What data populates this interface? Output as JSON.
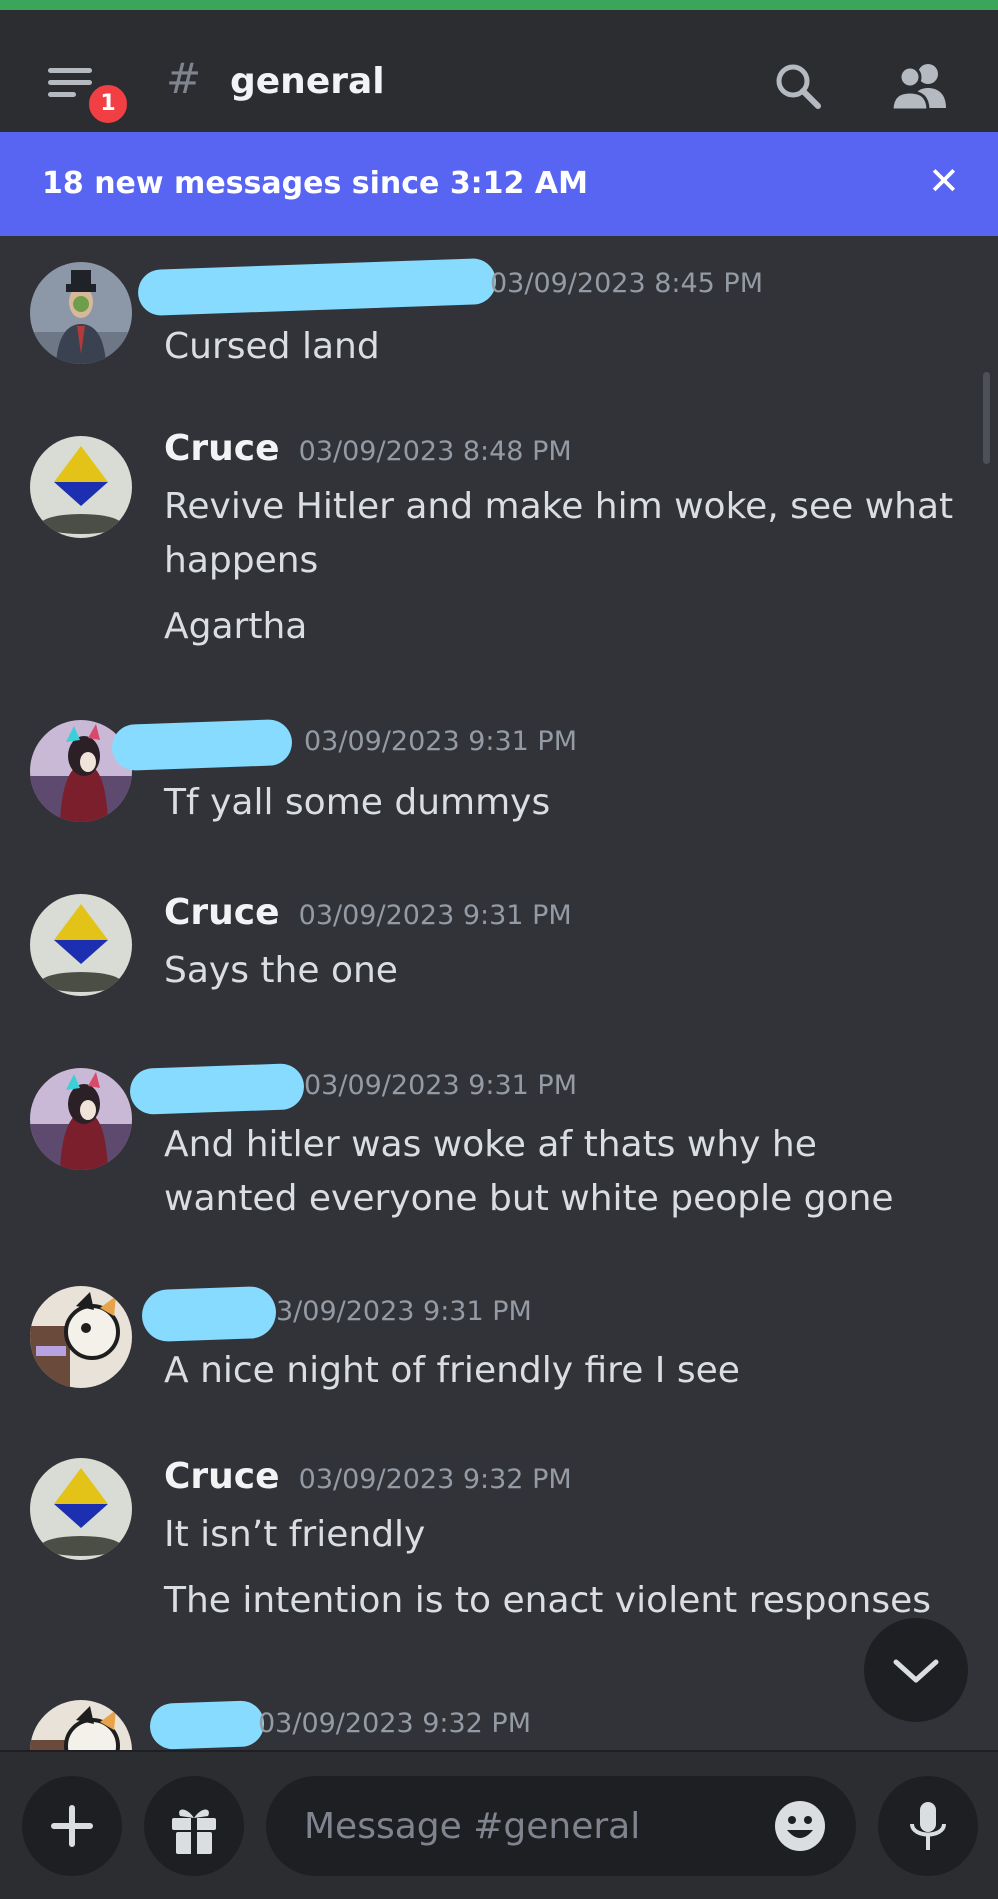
{
  "header": {
    "menu_badge_count": "1",
    "channel_name": "general"
  },
  "banner": {
    "text": "18 new messages since 3:12 AM",
    "close_glyph": "✕"
  },
  "messages": [
    {
      "author": "",
      "author_redacted": true,
      "timestamp": "03/09/2023 8:45 PM",
      "lines": [
        "Cursed land"
      ]
    },
    {
      "author": "Cruce",
      "author_redacted": false,
      "timestamp": "03/09/2023 8:48 PM",
      "lines": [
        "Revive Hitler and make him woke, see what happens",
        "Agartha"
      ]
    },
    {
      "author": "",
      "author_redacted": true,
      "timestamp": "03/09/2023 9:31 PM",
      "lines": [
        "Tf yall some dummys"
      ]
    },
    {
      "author": "Cruce",
      "author_redacted": false,
      "timestamp": "03/09/2023 9:31 PM",
      "lines": [
        "Says the one"
      ]
    },
    {
      "author": "",
      "author_redacted": true,
      "timestamp": "03/09/2023 9:31 PM",
      "lines": [
        "And hitler was woke af thats why he wanted everyone but white people gone"
      ]
    },
    {
      "author": "",
      "author_redacted": true,
      "timestamp": "3/09/2023 9:31 PM",
      "lines": [
        "A nice night of friendly fire I see"
      ]
    },
    {
      "author": "Cruce",
      "author_redacted": false,
      "timestamp": "03/09/2023 9:32 PM",
      "lines": [
        "It isn’t friendly",
        "The intention is to enact violent responses"
      ]
    },
    {
      "author": "",
      "author_redacted": true,
      "timestamp": "03/09/2023 9:32 PM",
      "lines": []
    }
  ],
  "composer": {
    "placeholder": "Message #general"
  },
  "icons": {
    "menu": "hamburger-menu-icon",
    "hash": "hash-icon",
    "search": "search-icon",
    "members": "members-icon",
    "close": "close-icon",
    "jump": "chevron-down-icon",
    "plus": "plus-icon",
    "gift": "gift-icon",
    "emoji": "emoji-icon",
    "mic": "microphone-icon"
  },
  "colors": {
    "background": "#313338",
    "header": "#2b2d31",
    "banner": "#5865f2",
    "badge": "#f23f43",
    "redaction": "#87dbff"
  }
}
